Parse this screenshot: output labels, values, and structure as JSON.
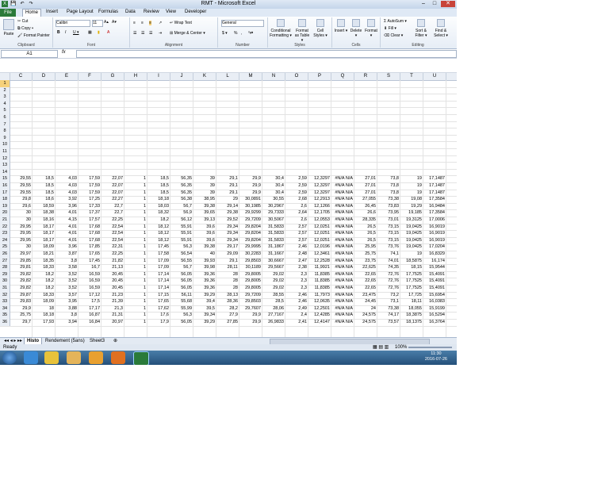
{
  "window": {
    "title": "RMT - Microsoft Excel",
    "min_glyph": "–",
    "max_glyph": "□",
    "close_glyph": "✕"
  },
  "quick_access": {
    "save_glyph": "💾",
    "undo_glyph": "↶",
    "redo_glyph": "↷"
  },
  "ribbon_tabs": {
    "file": "File",
    "home": "Home",
    "insert": "Insert",
    "page_layout": "Page Layout",
    "formulas": "Formulas",
    "data": "Data",
    "review": "Review",
    "view": "View",
    "developer": "Developer"
  },
  "clipboard": {
    "paste": "Paste",
    "cut": "Cut",
    "copy": "Copy ▾",
    "format_painter": "Format Painter",
    "label": "Clipboard"
  },
  "font": {
    "name": "Calibri",
    "size": "11",
    "grow": "A▴",
    "shrink": "A▾",
    "bold": "B",
    "italic": "I",
    "underline": "U ▾",
    "label": "Font"
  },
  "alignment": {
    "wrap_text": "Wrap Text",
    "merge_center": "Merge & Center ▾",
    "label": "Alignment"
  },
  "number": {
    "format": "General",
    "currency": "$ ▾",
    "percent": "%",
    "comma": ",",
    "label": "Number"
  },
  "styles": {
    "conditional": "Conditional Formatting ▾",
    "format_table": "Format as Table ▾",
    "cell_styles": "Cell Styles ▾",
    "label": "Styles"
  },
  "cells": {
    "insert": "Insert ▾",
    "delete": "Delete ▾",
    "format": "Format ▾",
    "label": "Cells"
  },
  "editing": {
    "autosum": "Σ AutoSum ▾",
    "fill": "Fill ▾",
    "clear": "Clear ▾",
    "sort_filter": "Sort & Filter ▾",
    "find_select": "Find & Select ▾",
    "label": "Editing"
  },
  "formula_bar": {
    "name_box": "A1",
    "fx": "fx",
    "value": ""
  },
  "columns": [
    "C",
    "D",
    "E",
    "F",
    "G",
    "H",
    "I",
    "J",
    "K",
    "L",
    "M",
    "N",
    "O",
    "P",
    "Q",
    "R",
    "S",
    "T",
    "U"
  ],
  "rows": [
    {
      "n": "1",
      "c": []
    },
    {
      "n": "2",
      "c": []
    },
    {
      "n": "3",
      "c": []
    },
    {
      "n": "4",
      "c": []
    },
    {
      "n": "5",
      "c": []
    },
    {
      "n": "6",
      "c": []
    },
    {
      "n": "7",
      "c": []
    },
    {
      "n": "8",
      "c": []
    },
    {
      "n": "9",
      "c": []
    },
    {
      "n": "10",
      "c": []
    },
    {
      "n": "11",
      "c": []
    },
    {
      "n": "12",
      "c": []
    },
    {
      "n": "13",
      "c": []
    },
    {
      "n": "14",
      "c": []
    },
    {
      "n": "15",
      "c": [
        "29,55",
        "18,5",
        "4,03",
        "17,59",
        "22,07",
        "1",
        "18,5",
        "56,35",
        "39",
        "29,1",
        "29,9",
        "30,4",
        "2,59",
        "12,3297",
        "#N/A N/A",
        "27,01",
        "73,8",
        "19",
        "17,1487"
      ]
    },
    {
      "n": "16",
      "c": [
        "29,55",
        "18,5",
        "4,03",
        "17,59",
        "22,07",
        "1",
        "18,5",
        "56,35",
        "39",
        "29,1",
        "29,9",
        "30,4",
        "2,59",
        "12,3297",
        "#N/A N/A",
        "27,01",
        "73,8",
        "19",
        "17,1487"
      ]
    },
    {
      "n": "17",
      "c": [
        "29,55",
        "18,5",
        "4,03",
        "17,59",
        "22,07",
        "1",
        "18,5",
        "56,35",
        "39",
        "29,1",
        "29,9",
        "30,4",
        "2,59",
        "12,3297",
        "#N/A N/A",
        "27,01",
        "73,8",
        "19",
        "17,1487"
      ]
    },
    {
      "n": "18",
      "c": [
        "29,8",
        "18,6",
        "3,92",
        "17,25",
        "22,27",
        "1",
        "18,18",
        "56,38",
        "38,95",
        "29",
        "30,0891",
        "30,55",
        "2,68",
        "12,2913",
        "#N/A N/A",
        "27,055",
        "73,38",
        "19,08",
        "17,3584"
      ]
    },
    {
      "n": "19",
      "c": [
        "29,6",
        "18,59",
        "3,96",
        "17,33",
        "22,7",
        "1",
        "18,03",
        "56,7",
        "39,38",
        "29,14",
        "30,1985",
        "30,2967",
        "2,6",
        "12,1266",
        "#N/A N/A",
        "26,45",
        "73,83",
        "19,29",
        "16,9484"
      ]
    },
    {
      "n": "20",
      "c": [
        "30",
        "18,38",
        "4,01",
        "17,37",
        "22,7",
        "1",
        "18,32",
        "56,9",
        "39,65",
        "29,38",
        "29,9299",
        "29,7333",
        "2,64",
        "12,1705",
        "#N/A N/A",
        "26,6",
        "73,95",
        "19,185",
        "17,3584"
      ]
    },
    {
      "n": "21",
      "c": [
        "30",
        "18,16",
        "4,15",
        "17,57",
        "22,25",
        "1",
        "18,2",
        "56,12",
        "39,13",
        "29,52",
        "29,7209",
        "30,5067",
        "2,6",
        "12,0553",
        "#N/A N/A",
        "28,335",
        "73,01",
        "19,3125",
        "17,0006"
      ]
    },
    {
      "n": "22",
      "c": [
        "29,95",
        "18,17",
        "4,01",
        "17,68",
        "22,54",
        "1",
        "18,12",
        "55,91",
        "39,6",
        "29,34",
        "29,8204",
        "31,5833",
        "2,57",
        "12,0251",
        "#N/A N/A",
        "26,5",
        "73,15",
        "19,0425",
        "16,9019"
      ]
    },
    {
      "n": "23",
      "c": [
        "29,95",
        "18,17",
        "4,01",
        "17,68",
        "22,54",
        "1",
        "18,12",
        "55,91",
        "39,6",
        "29,34",
        "29,8204",
        "31,5833",
        "2,57",
        "12,0251",
        "#N/A N/A",
        "26,5",
        "73,15",
        "19,0425",
        "16,9019"
      ]
    },
    {
      "n": "24",
      "c": [
        "29,95",
        "18,17",
        "4,01",
        "17,68",
        "22,54",
        "1",
        "18,12",
        "55,91",
        "39,6",
        "29,34",
        "29,8204",
        "31,5833",
        "2,57",
        "12,0251",
        "#N/A N/A",
        "26,5",
        "73,15",
        "19,0425",
        "16,9019"
      ]
    },
    {
      "n": "25",
      "c": [
        "30",
        "18,09",
        "3,96",
        "17,85",
        "22,31",
        "1",
        "17,45",
        "56,3",
        "39,38",
        "29,17",
        "29,9995",
        "31,1867",
        "2,46",
        "12,0196",
        "#N/A N/A",
        "25,95",
        "73,76",
        "19,0425",
        "17,0204"
      ]
    },
    {
      "n": "26",
      "c": [
        "29,97",
        "18,21",
        "3,87",
        "17,65",
        "22,25",
        "1",
        "17,58",
        "56,54",
        "40",
        "29,09",
        "30,2283",
        "31,1667",
        "2,48",
        "12,3461",
        "#N/A N/A",
        "25,75",
        "74,1",
        "19",
        "16,8329"
      ]
    },
    {
      "n": "27",
      "c": [
        "29,85",
        "18,35",
        "3,8",
        "17,45",
        "21,82",
        "1",
        "17,09",
        "56,55",
        "39,93",
        "29,1",
        "29,8503",
        "30,6667",
        "2,47",
        "12,2528",
        "#N/A N/A",
        "23,75",
        "74,01",
        "18,5875",
        "16,174"
      ]
    },
    {
      "n": "28",
      "c": [
        "29,81",
        "18,33",
        "3,58",
        "16,7",
        "21,13",
        "1",
        "17,09",
        "56,7",
        "39,98",
        "28,11",
        "30,1189",
        "29,5667",
        "2,38",
        "11,9921",
        "#N/A N/A",
        "22,625",
        "74,35",
        "18,15",
        "15,9544"
      ]
    },
    {
      "n": "29",
      "c": [
        "29,82",
        "18,2",
        "3,52",
        "16,59",
        "20,45",
        "1",
        "17,14",
        "56,05",
        "39,36",
        "28",
        "29,8005",
        "29,02",
        "2,3",
        "11,8385",
        "#N/A N/A",
        "22,65",
        "72,76",
        "17,7525",
        "15,4091"
      ]
    },
    {
      "n": "30",
      "c": [
        "29,82",
        "18,2",
        "3,52",
        "16,59",
        "20,45",
        "1",
        "17,14",
        "56,05",
        "39,36",
        "28",
        "29,8005",
        "29,02",
        "2,3",
        "11,8385",
        "#N/A N/A",
        "22,65",
        "72,76",
        "17,7525",
        "15,4091"
      ]
    },
    {
      "n": "31",
      "c": [
        "29,82",
        "18,2",
        "3,52",
        "16,59",
        "20,45",
        "1",
        "17,14",
        "56,05",
        "39,36",
        "28",
        "29,8005",
        "29,02",
        "2,3",
        "11,8385",
        "#N/A N/A",
        "22,65",
        "72,76",
        "17,7525",
        "15,4091"
      ]
    },
    {
      "n": "32",
      "c": [
        "29,87",
        "18,33",
        "3,57",
        "17,12",
        "21,23",
        "1",
        "17,15",
        "56,11",
        "39,29",
        "28,13",
        "29,7209",
        "28,55",
        "2,46",
        "11,7973",
        "#N/A N/A",
        "23,475",
        "73,2",
        "17,725",
        "15,6954"
      ]
    },
    {
      "n": "33",
      "c": [
        "29,83",
        "18,09",
        "3,95",
        "17,5",
        "21,39",
        "1",
        "17,65",
        "55,68",
        "39,4",
        "28,36",
        "29,8503",
        "28,5",
        "2,46",
        "12,0635",
        "#N/A N/A",
        "24,45",
        "73,1",
        "18,11",
        "16,0383"
      ]
    },
    {
      "n": "34",
      "c": [
        "29,9",
        "18",
        "3,88",
        "17,17",
        "21,3",
        "1",
        "17,62",
        "55,99",
        "39,5",
        "28,2",
        "29,7607",
        "28,06",
        "2,49",
        "12,2501",
        "#N/A N/A",
        "24",
        "73,38",
        "18,055",
        "15,9199"
      ]
    },
    {
      "n": "35",
      "c": [
        "25,75",
        "18,18",
        "3,8",
        "16,87",
        "21,31",
        "1",
        "17,6",
        "56,3",
        "39,34",
        "27,9",
        "29,9",
        "27,7167",
        "2,4",
        "12,4285",
        "#N/A N/A",
        "24,575",
        "74,17",
        "18,3875",
        "16,5294"
      ]
    },
    {
      "n": "36",
      "c": [
        "29,7",
        "17,93",
        "3,94",
        "16,84",
        "20,97",
        "1",
        "17,9",
        "56,05",
        "39,29",
        "27,85",
        "29,9",
        "26,9833",
        "2,41",
        "12,4147",
        "#N/A N/A",
        "24,575",
        "73,57",
        "18,1375",
        "16,3764"
      ]
    }
  ],
  "sheets": {
    "histo": "Histo",
    "rendement": "Rendement (5ans)",
    "sheet3": "Sheet3"
  },
  "status": {
    "ready": "Ready",
    "zoom": "100%"
  },
  "taskbar": {
    "time": "11:30",
    "date": "2016-07-26"
  },
  "colors": {
    "excel_green": "#2a7a3a",
    "ribbon_bg": "#e6edf6",
    "selected_row": "#f6d17a"
  }
}
